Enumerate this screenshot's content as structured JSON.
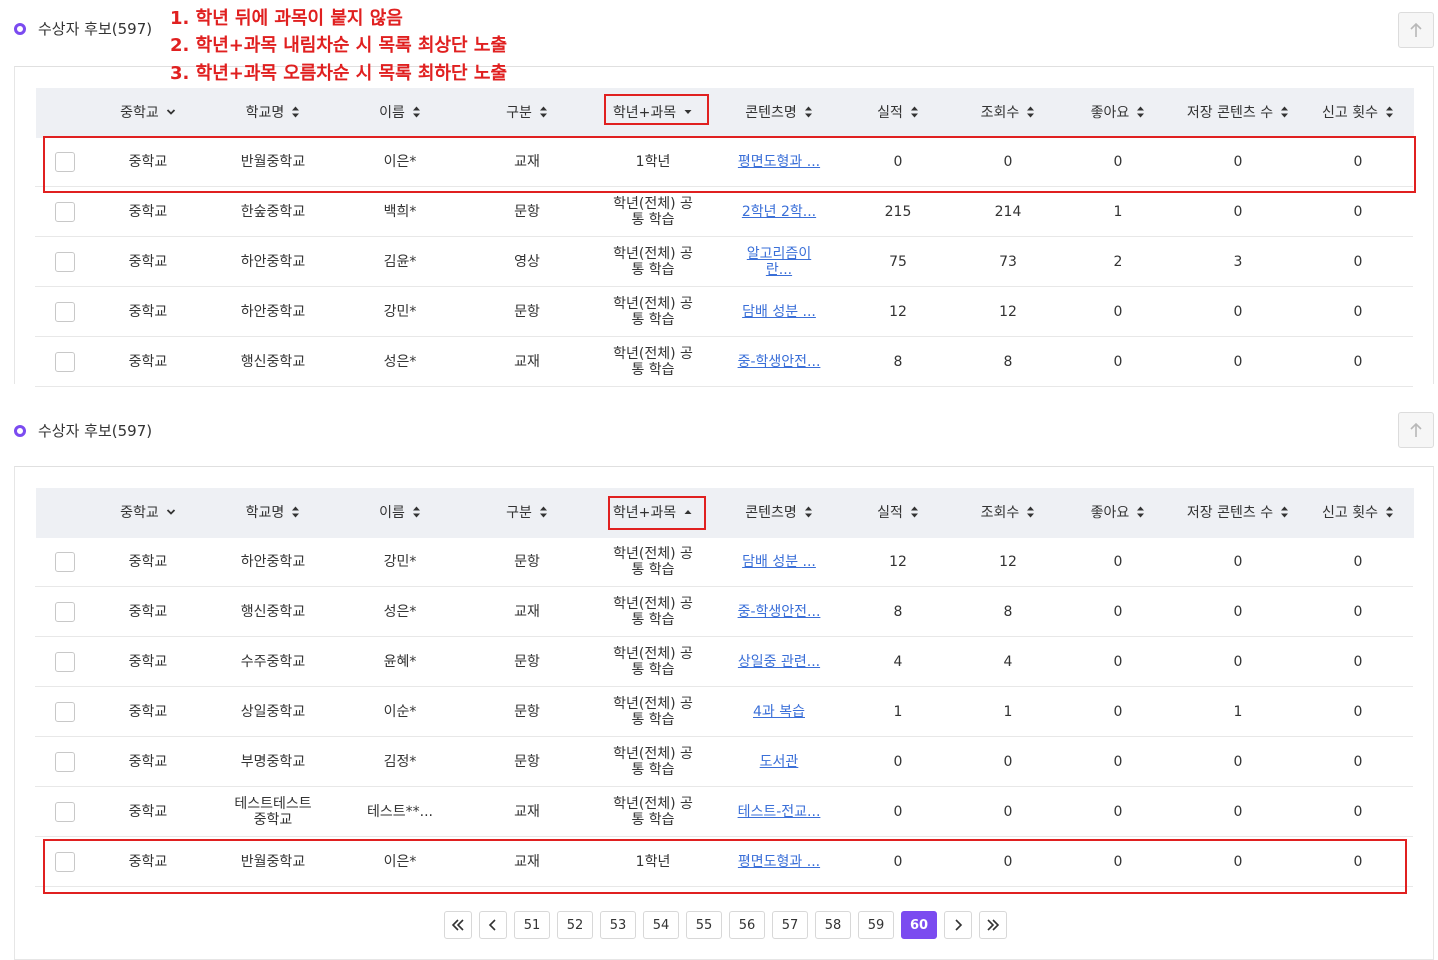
{
  "section_title": "수상자 후보(597)",
  "annotations": [
    "1. 학년 뒤에 과목이 붙지 않음",
    "2. 학년+과목 내림차순 시 목록 최상단 노출",
    "3. 학년+과목 오름차순 시 목록 최하단 노출"
  ],
  "columns": [
    "중학교",
    "학교명",
    "이름",
    "구분",
    "학년+과목",
    "콘텐츠명",
    "실적",
    "조회수",
    "좋아요",
    "저장 콘텐츠 수",
    "신고 횟수"
  ],
  "table1_rows": [
    {
      "level": "중학교",
      "school": "반월중학교",
      "name": "이은*",
      "type": "교재",
      "grade": "1학년",
      "content": "평면도형과 ...",
      "perf": "0",
      "views": "0",
      "likes": "0",
      "saved": "0",
      "reports": "0"
    },
    {
      "level": "중학교",
      "school": "한숲중학교",
      "name": "백희*",
      "type": "문항",
      "grade": "학년(전체) 공통 학습",
      "content": "2학년 2학...",
      "perf": "215",
      "views": "214",
      "likes": "1",
      "saved": "0",
      "reports": "0"
    },
    {
      "level": "중학교",
      "school": "하안중학교",
      "name": "김윤*",
      "type": "영상",
      "grade": "학년(전체) 공통 학습",
      "content": "알고리즘이 란...",
      "perf": "75",
      "views": "73",
      "likes": "2",
      "saved": "3",
      "reports": "0"
    },
    {
      "level": "중학교",
      "school": "하안중학교",
      "name": "강민*",
      "type": "문항",
      "grade": "학년(전체) 공통 학습",
      "content": "담배 성분 ...",
      "perf": "12",
      "views": "12",
      "likes": "0",
      "saved": "0",
      "reports": "0"
    },
    {
      "level": "중학교",
      "school": "행신중학교",
      "name": "성은*",
      "type": "교재",
      "grade": "학년(전체) 공통 학습",
      "content": "중-학생안전...",
      "perf": "8",
      "views": "8",
      "likes": "0",
      "saved": "0",
      "reports": "0"
    }
  ],
  "table2_rows": [
    {
      "level": "중학교",
      "school": "하안중학교",
      "name": "강민*",
      "type": "문항",
      "grade": "학년(전체) 공통 학습",
      "content": "담배 성분 ...",
      "perf": "12",
      "views": "12",
      "likes": "0",
      "saved": "0",
      "reports": "0"
    },
    {
      "level": "중학교",
      "school": "행신중학교",
      "name": "성은*",
      "type": "교재",
      "grade": "학년(전체) 공통 학습",
      "content": "중-학생안전...",
      "perf": "8",
      "views": "8",
      "likes": "0",
      "saved": "0",
      "reports": "0"
    },
    {
      "level": "중학교",
      "school": "수주중학교",
      "name": "윤혜*",
      "type": "문항",
      "grade": "학년(전체) 공통 학습",
      "content": "상일중 관련...",
      "perf": "4",
      "views": "4",
      "likes": "0",
      "saved": "0",
      "reports": "0"
    },
    {
      "level": "중학교",
      "school": "상일중학교",
      "name": "이순*",
      "type": "문항",
      "grade": "학년(전체) 공통 학습",
      "content": "4과 복습",
      "perf": "1",
      "views": "1",
      "likes": "0",
      "saved": "1",
      "reports": "0"
    },
    {
      "level": "중학교",
      "school": "부명중학교",
      "name": "김정*",
      "type": "문항",
      "grade": "학년(전체) 공통 학습",
      "content": "도서관",
      "perf": "0",
      "views": "0",
      "likes": "0",
      "saved": "0",
      "reports": "0"
    },
    {
      "level": "중학교",
      "school": "테스트테스트 중학교",
      "name": "테스트**...",
      "type": "교재",
      "grade": "학년(전체) 공통 학습",
      "content": "테스트-전교...",
      "perf": "0",
      "views": "0",
      "likes": "0",
      "saved": "0",
      "reports": "0"
    },
    {
      "level": "중학교",
      "school": "반월중학교",
      "name": "이은*",
      "type": "교재",
      "grade": "1학년",
      "content": "평면도형과 ...",
      "perf": "0",
      "views": "0",
      "likes": "0",
      "saved": "0",
      "reports": "0"
    }
  ],
  "pagination": {
    "pages": [
      "51",
      "52",
      "53",
      "54",
      "55",
      "56",
      "57",
      "58",
      "59",
      "60"
    ],
    "active": "60"
  },
  "accent_color": "#7b4bf0",
  "annotation_color": "#e02020",
  "link_color": "#3a6fd8"
}
